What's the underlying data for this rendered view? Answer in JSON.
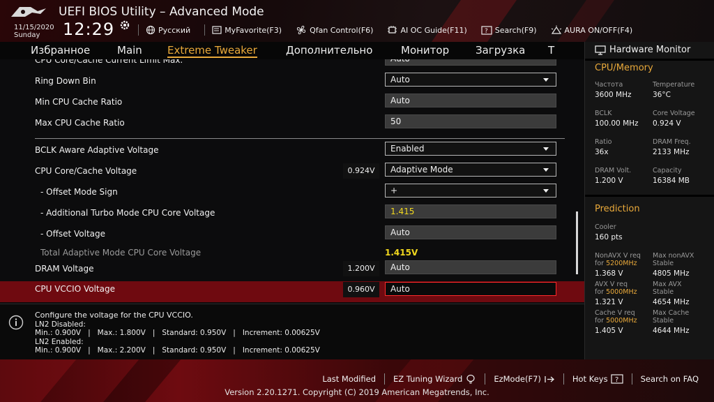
{
  "header": {
    "title": "UEFI BIOS Utility – Advanced Mode",
    "date": "11/15/2020",
    "day": "Sunday",
    "time": "12:29",
    "toolbar": [
      {
        "icon": "globe-icon",
        "label": "Русский"
      },
      {
        "icon": "myfavorite-icon",
        "label": "MyFavorite(F3)"
      },
      {
        "icon": "fan-icon",
        "label": "Qfan Control(F6)"
      },
      {
        "icon": "ai-oc-icon",
        "label": "AI OC Guide(F11)"
      },
      {
        "icon": "search-icon",
        "label": "Search(F9)"
      },
      {
        "icon": "aura-icon",
        "label": "AURA ON/OFF(F4)"
      }
    ]
  },
  "nav": {
    "tabs": [
      {
        "label": "Избранное",
        "active": false
      },
      {
        "label": "Main",
        "active": false
      },
      {
        "label": "Extreme Tweaker",
        "active": true
      },
      {
        "label": "Дополнительно",
        "active": false
      },
      {
        "label": "Монитор",
        "active": false
      },
      {
        "label": "Загрузка",
        "active": false
      },
      {
        "label": "Т",
        "active": false
      }
    ]
  },
  "settings": {
    "rows": [
      {
        "label": "CPU Core/Cache Current Limit Max.",
        "value": "Auto",
        "type": "text"
      },
      {
        "label": "Ring Down Bin",
        "value": "Auto",
        "type": "dropdown"
      },
      {
        "label": "Min CPU Cache Ratio",
        "value": "Auto",
        "type": "text"
      },
      {
        "label": "Max CPU Cache Ratio",
        "value": "50",
        "type": "text"
      },
      {
        "label": "BCLK Aware Adaptive Voltage",
        "value": "Enabled",
        "type": "dropdown"
      },
      {
        "label": "CPU Core/Cache Voltage",
        "current": "0.924V",
        "value": "Adaptive Mode",
        "type": "dropdown"
      },
      {
        "label": "- Offset Mode Sign",
        "value": "+",
        "type": "dropdown"
      },
      {
        "label": "- Additional Turbo Mode CPU Core Voltage",
        "value": "1.415",
        "type": "text"
      },
      {
        "label": "- Offset Voltage",
        "value": "Auto",
        "type": "text"
      },
      {
        "label": "Total Adaptive Mode CPU Core Voltage",
        "value": "1.415V",
        "type": "readonly"
      },
      {
        "label": "DRAM Voltage",
        "current": "1.200V",
        "value": "Auto",
        "type": "text"
      },
      {
        "label": "CPU VCCIO Voltage",
        "current": "0.960V",
        "value": "Auto",
        "type": "text",
        "selected": true
      }
    ]
  },
  "help": {
    "title": "Configure the voltage for the CPU VCCIO.",
    "lines": [
      "LN2 Disabled:",
      "Min.: 0.900V   |   Max.: 1.800V   |   Standard: 0.950V   |   Increment: 0.00625V",
      "LN2 Enabled:",
      "Min.: 0.900V   |   Max.: 2.200V   |   Standard: 0.950V   |   Increment: 0.00625V"
    ]
  },
  "hwmon": {
    "title": "Hardware Monitor",
    "cpu_memory": {
      "heading": "CPU/Memory",
      "items": [
        {
          "label": "Частота",
          "value": "3600 MHz"
        },
        {
          "label": "Temperature",
          "value": "36°C"
        },
        {
          "label": "BCLK",
          "value": "100.00 MHz"
        },
        {
          "label": "Core Voltage",
          "value": "0.924 V"
        },
        {
          "label": "Ratio",
          "value": "36x"
        },
        {
          "label": "DRAM Freq.",
          "value": "2133 MHz"
        },
        {
          "label": "DRAM Volt.",
          "value": "1.200 V"
        },
        {
          "label": "Capacity",
          "value": "16384 MB"
        }
      ]
    },
    "prediction": {
      "heading": "Prediction",
      "cooler_label": "Cooler",
      "cooler_value": "160 pts",
      "nonavx_label": "NonAVX V req",
      "nonavx_for": "for ",
      "nonavx_freq": "5200MHz",
      "nonavx_value": "1.368 V",
      "max_nonavx_label1": "Max nonAVX",
      "max_nonavx_label2": "Stable",
      "max_nonavx_value": "4805 MHz",
      "avx_label": "AVX V req",
      "avx_for": "for ",
      "avx_freq": "5000MHz",
      "avx_value": "1.321 V",
      "max_avx_label1": "Max AVX",
      "max_avx_label2": "Stable",
      "max_avx_value": "4654 MHz",
      "cache_label": "Cache V req",
      "cache_for": "for ",
      "cache_freq": "5000MHz",
      "cache_value": "1.405 V",
      "max_cache_label1": "Max Cache",
      "max_cache_label2": "Stable",
      "max_cache_value": "4644 MHz"
    }
  },
  "footer": {
    "items": [
      "Last Modified",
      "EZ Tuning Wizard",
      "EzMode(F7)",
      "Hot Keys",
      "Search on FAQ"
    ],
    "version": "Version 2.20.1271. Copyright (C) 2019 American Megatrends, Inc."
  },
  "colors": {
    "accent": "#e9a93a",
    "highlight_value": "#f2d81e",
    "selected_row": "#6f0a10",
    "selected_border": "#ff2a2a"
  }
}
